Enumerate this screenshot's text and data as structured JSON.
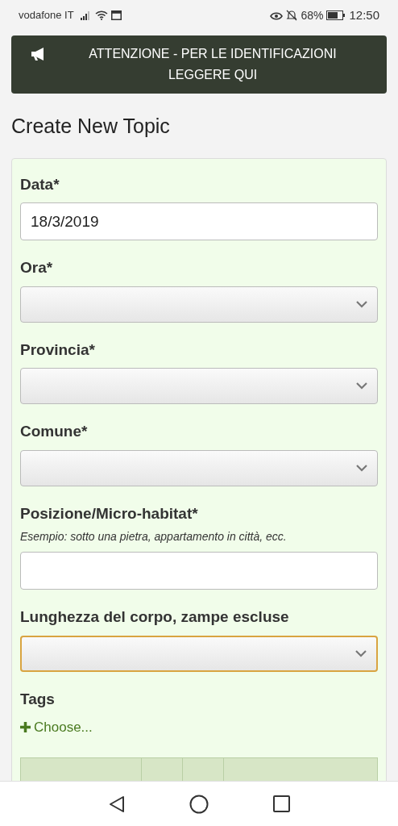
{
  "status_bar": {
    "carrier": "vodafone IT",
    "battery": "68%",
    "time": "12:50"
  },
  "banner": {
    "text": "ATTENZIONE - PER LE IDENTIFICAZIONI LEGGERE QUI"
  },
  "title": "Create New Topic",
  "fields": [
    {
      "kind": "text",
      "label": "Data*",
      "value": "18/3/2019",
      "focused": false
    },
    {
      "kind": "select",
      "label": "Ora*",
      "focused": false
    },
    {
      "kind": "select",
      "label": "Provincia*",
      "focused": false
    },
    {
      "kind": "select",
      "label": "Comune*",
      "focused": false
    },
    {
      "kind": "text",
      "label": "Posizione/Micro-habitat*",
      "hint": "Esempio: sotto una pietra, appartamento in città, ecc.",
      "focused": false
    },
    {
      "kind": "select",
      "label": "Lunghezza del corpo, zampe escluse",
      "focused": true
    }
  ],
  "tags": {
    "label": "Tags",
    "action": "Choose..."
  }
}
